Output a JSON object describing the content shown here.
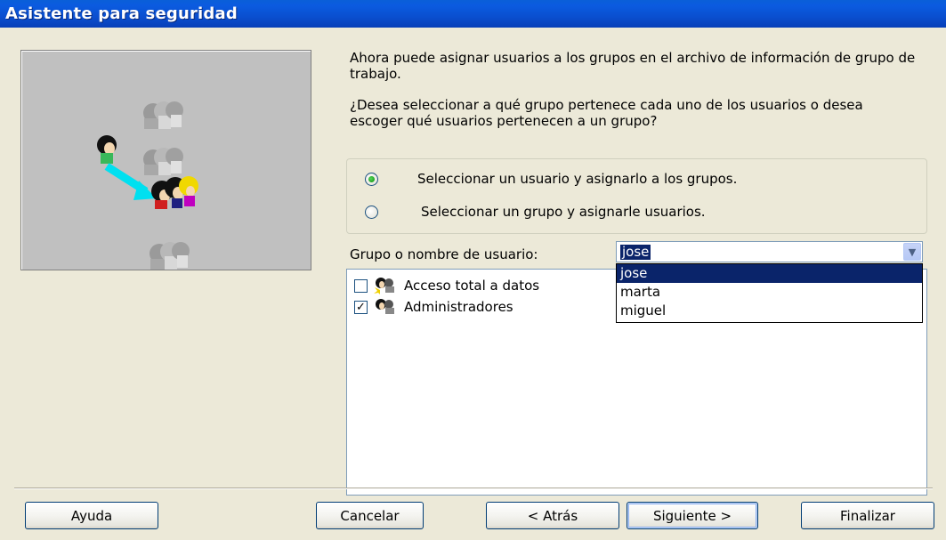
{
  "window": {
    "title": "Asistente para seguridad"
  },
  "intro": {
    "paragraph1": "Ahora puede asignar usuarios a los grupos en el archivo de información de grupo de trabajo.",
    "paragraph2": "¿Desea seleccionar a qué grupo pertenece cada uno de los usuarios o desea escoger qué usuarios pertenecen a un grupo?"
  },
  "options": [
    {
      "label": "Seleccionar un usuario y asignarlo a los grupos.",
      "checked": true
    },
    {
      "label": "Seleccionar un grupo y asignarle usuarios.",
      "checked": false
    }
  ],
  "user_field": {
    "label": "Grupo o nombre de usuario:",
    "value": "jose",
    "options": [
      "jose",
      "marta",
      "miguel"
    ]
  },
  "groups": [
    {
      "name": "Acceso total a datos",
      "checked": false
    },
    {
      "name": "Administradores",
      "checked": true
    }
  ],
  "buttons": {
    "help": "Ayuda",
    "cancel": "Cancelar",
    "back": "< Atrás",
    "next": "Siguiente >",
    "finish": "Finalizar"
  },
  "colors": {
    "title_bar": "#0a5fd8",
    "selection": "#0a246a",
    "window_bg": "#ece9d8"
  },
  "icons": [
    "users-group-icon",
    "arrow-icon",
    "dropdown-arrow-icon",
    "group-icon",
    "admin-group-icon"
  ]
}
